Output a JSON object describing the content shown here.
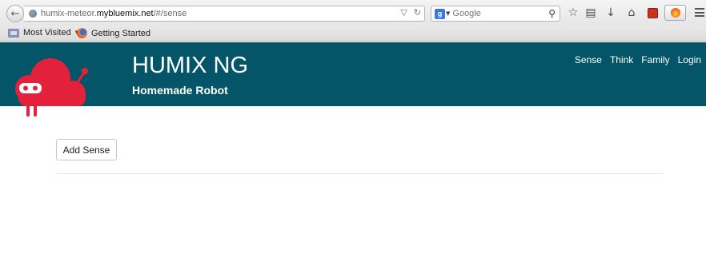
{
  "browser": {
    "url_prefix": "humix-meteor.",
    "url_domain": "mybluemix.net",
    "url_suffix": "/#/sense",
    "search_placeholder": "Google",
    "bookmarks": [
      {
        "label": "Most Visited",
        "icon": "folder-icon"
      },
      {
        "label": "Getting Started",
        "icon": "firefox-icon"
      }
    ]
  },
  "header": {
    "title": "HUMIX NG",
    "subtitle": "Homemade Robot",
    "background_color": "#045568",
    "logo_color": "#e4213b",
    "nav": [
      "Sense",
      "Think",
      "Family",
      "Login"
    ]
  },
  "main": {
    "add_sense_label": "Add Sense"
  }
}
